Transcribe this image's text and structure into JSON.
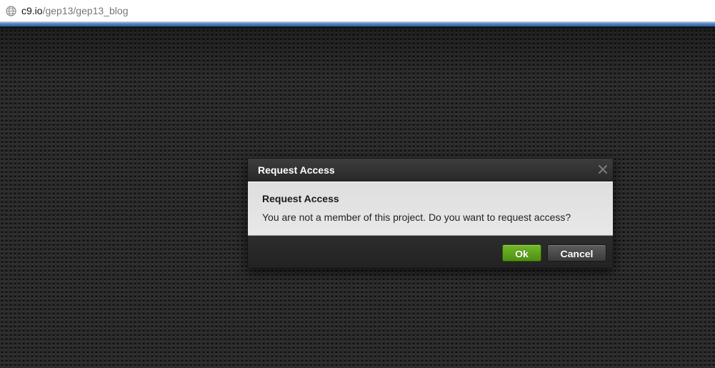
{
  "browser": {
    "url_host": "c9.io",
    "url_path": "/gep13/gep13_blog"
  },
  "dialog": {
    "title": "Request Access",
    "heading": "Request Access",
    "message": "You are not a member of this project. Do you want to request access?",
    "ok_label": "Ok",
    "cancel_label": "Cancel",
    "close_icon": "close-icon"
  },
  "colors": {
    "ok_button": "#5fa11d",
    "cancel_button": "#4a4a4a",
    "browser_accent": "#4a7fbf"
  }
}
